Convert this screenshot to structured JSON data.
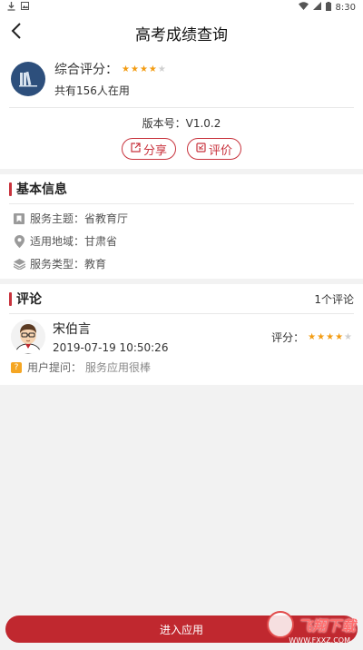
{
  "status_bar": {
    "time": "8:30"
  },
  "header": {
    "title": "高考成绩查询"
  },
  "app": {
    "rating_label": "综合评分：",
    "rating": 4,
    "rating_max": 5,
    "users_text": "共有156人在用",
    "version_text": "版本号：V1.0.2",
    "share_label": "分享",
    "review_label": "评价"
  },
  "basic_info": {
    "title": "基本信息",
    "rows": [
      {
        "icon": "bookmark-icon",
        "text": "服务主题：省教育厅"
      },
      {
        "icon": "location-pin-icon",
        "text": "适用地域：甘肃省"
      },
      {
        "icon": "layers-icon",
        "text": "服务类型：教育"
      }
    ]
  },
  "comments": {
    "title": "评论",
    "count_text": "1个评论",
    "items": [
      {
        "name": "宋伯言",
        "time": "2019-07-19 10:50:26",
        "score_label": "评分：",
        "rating": 4,
        "question_label": "用户提问：",
        "question_text": "服务应用很棒"
      }
    ]
  },
  "bottom": {
    "enter_label": "进入应用"
  },
  "watermark": {
    "text": "飞翔下载",
    "sub": "WWW.FXXZ.COM"
  },
  "colors": {
    "accent": "#c0282f",
    "star": "#f39c12",
    "logo_bg": "#2d4f7c"
  }
}
